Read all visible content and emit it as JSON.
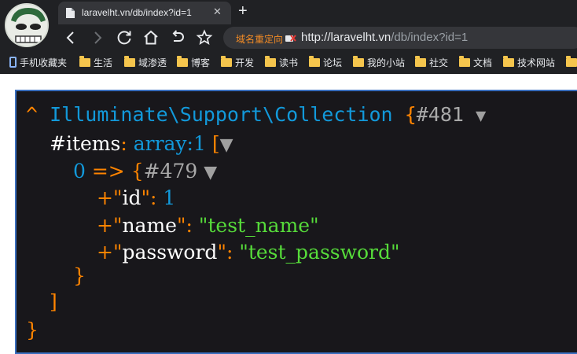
{
  "tab": {
    "title": "laravelht.vn/db/index?id=1",
    "close_glyph": "✕"
  },
  "new_tab_glyph": "+",
  "address_bar": {
    "redirect_label": "域名重定向",
    "url_host": "http://laravelht.vn",
    "url_path": "/db/index?id=1"
  },
  "bookmarks": [
    {
      "label": "手机收藏夹",
      "icon": "phone-icon"
    },
    {
      "label": "生活",
      "icon": "folder-icon"
    },
    {
      "label": "域渗透",
      "icon": "folder-icon"
    },
    {
      "label": "博客",
      "icon": "folder-icon"
    },
    {
      "label": "开发",
      "icon": "folder-icon"
    },
    {
      "label": "读书",
      "icon": "folder-icon"
    },
    {
      "label": "论坛",
      "icon": "folder-icon"
    },
    {
      "label": "我的小站",
      "icon": "folder-icon"
    },
    {
      "label": "社交",
      "icon": "folder-icon"
    },
    {
      "label": "文档",
      "icon": "folder-icon"
    },
    {
      "label": "技术网站",
      "icon": "folder-icon"
    }
  ],
  "dump": {
    "caret": "^",
    "class_name": "Illuminate\\Support\\Collection",
    "open_brace": "{",
    "object_id": "#481",
    "toggle_glyph": "▼",
    "items_key": "#items",
    "colon": ":",
    "items_type": "array:1",
    "open_bracket": "[",
    "index": "0",
    "arrow": "=>",
    "inner_open_brace": "{",
    "inner_object_id": "#479",
    "plus": "+",
    "quote": "\"",
    "fields": [
      {
        "key": "id",
        "value": "1",
        "kind": "number"
      },
      {
        "key": "name",
        "value": "\"test_name\"",
        "kind": "string"
      },
      {
        "key": "password",
        "value": "\"test_password\"",
        "kind": "string"
      }
    ],
    "inner_close_brace": "}",
    "close_bracket": "]",
    "close_brace": "}"
  },
  "colors": {
    "chrome_bg": "#202124",
    "dump_bg": "#18171b",
    "dump_border": "#3a6fbf",
    "punctuation": "#ff8400",
    "class_blue": "#1299da",
    "string_green": "#56db3a",
    "folder_yellow": "#f5c54d",
    "redirect_orange": "#f28b25"
  }
}
